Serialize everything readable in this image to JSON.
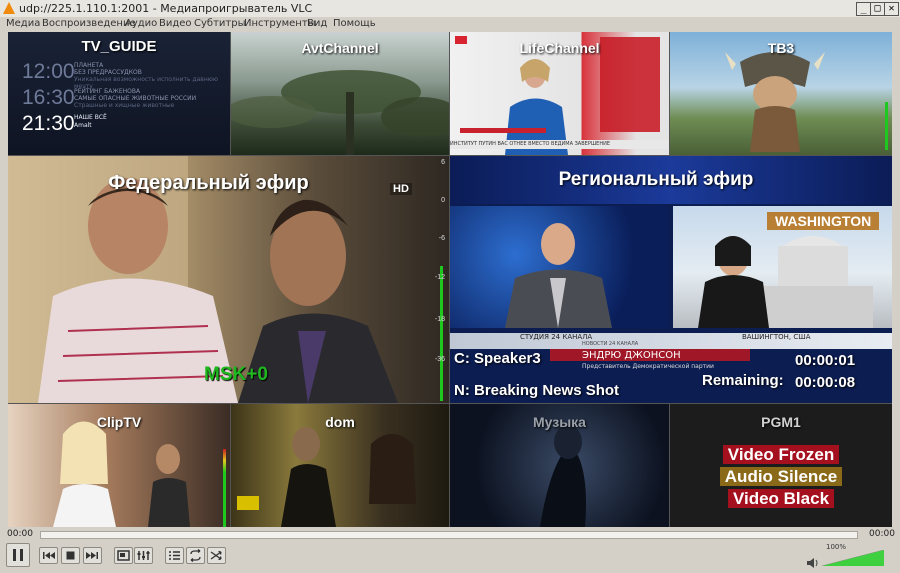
{
  "window": {
    "title": "udp://225.1.110.1:2001 - Медиапроигрыватель VLC",
    "minimize_label": "_",
    "maximize_label": "□",
    "close_label": "✕"
  },
  "menu": [
    "Медиа",
    "Воспроизведение",
    "Аудио",
    "Видео",
    "Субтитры",
    "Инструменты",
    "Вид",
    "Помощь"
  ],
  "mosaic": {
    "tv_guide": {
      "title": "TV_GUIDE",
      "rows": [
        {
          "time": "12:00",
          "lines": [
            "ПЛАНЕТА",
            "БЕЗ ПРЕДРАССУДКОВ",
            "Уникальная возможность исполнить давнюю мечту"
          ]
        },
        {
          "time": "16:30",
          "lines": [
            "РЕЙТИНГ БАЖЕНОВА",
            "САМЫЕ ОПАСНЫЕ ЖИВОТНЫЕ РОССИИ",
            "Страшные и хищные животные"
          ]
        },
        {
          "time": "21:30",
          "lines": [
            "НАШЕ ВСЁ",
            "Amalt"
          ]
        }
      ]
    },
    "avt": {
      "title": "AvtChannel"
    },
    "life": {
      "title": "LifeChannel",
      "ticker": "ИНСТИТУТ ПУТИН ВАС ОТНЕЕ ВМЕСТО ВЕДИМА ЗАВЕРШЕНИЕ"
    },
    "tv3": {
      "title": "ТВ3"
    },
    "federal": {
      "title": "Федеральный эфир",
      "overlay": "MSK+0",
      "logo": "HD"
    },
    "regional": {
      "title": "Региональный эфир",
      "washington": "WASHINGTON",
      "studio_caption": "СТУДИЯ 24 КАНАЛА",
      "studio_sub": "НОВОСТИ 24 КАНАЛА",
      "location_caption": "ВАШИНГТОН, США",
      "name_caption": "ЭНДРЮ ДЖОНСОН",
      "role_caption": "Представитель Демократической партии",
      "speaker": "C: Speaker3",
      "timecode": "00:00:01",
      "remaining_label": "Remaining:",
      "remaining_time": "00:00:08",
      "news": "N: Breaking News Shot"
    },
    "cliptv": {
      "title": "ClipTV"
    },
    "dom": {
      "title": "dom"
    },
    "muzyka": {
      "title": "Музыка"
    },
    "pgm1": {
      "title": "PGM1",
      "alarms": [
        "Video Frozen",
        "Audio Silence",
        "Video Black"
      ],
      "alarm_colors": {
        "frozen": "#a4101e",
        "silence": "#8a6a18",
        "black": "#a4101e"
      }
    },
    "scale_labels": [
      "6",
      "0",
      "-6",
      "-12",
      "-18",
      "-36"
    ]
  },
  "player": {
    "time_elapsed": "00:00",
    "time_total": "00:00",
    "volume": "100%",
    "volume_level": 1.0,
    "buttons": [
      "pause-icon",
      "previous-icon",
      "stop-icon",
      "next-icon",
      "fullscreen-icon",
      "extended-settings-icon",
      "playlist-icon",
      "loop-icon",
      "shuffle-icon"
    ]
  },
  "colors": {
    "accent": "#f08a0c",
    "msk": "#1fb81f",
    "meter_green": "#1ec81e"
  }
}
